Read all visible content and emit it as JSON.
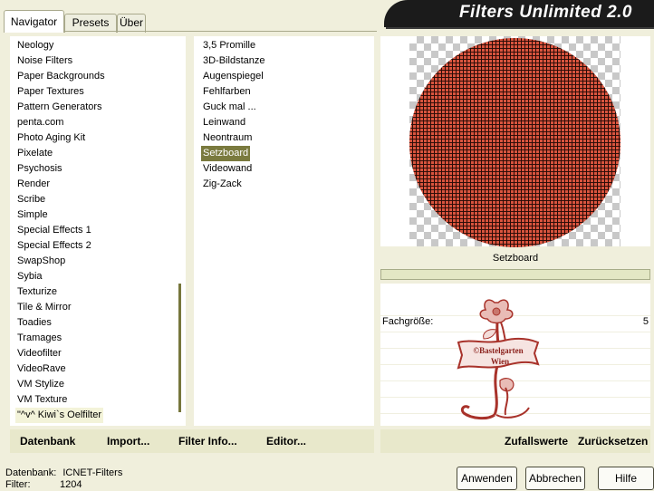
{
  "header": {
    "title": "Filters Unlimited 2.0"
  },
  "tabs": [
    {
      "label": "Navigator",
      "active": true
    },
    {
      "label": "Presets",
      "active": false
    },
    {
      "label": "Über",
      "active": false
    }
  ],
  "categories": [
    "Neology",
    "Noise Filters",
    "Paper Backgrounds",
    "Paper Textures",
    "Pattern Generators",
    "penta.com",
    "Photo Aging Kit",
    "Pixelate",
    "Psychosis",
    "Render",
    "Scribe",
    "Simple",
    "Special Effects 1",
    "Special Effects 2",
    "SwapShop",
    "Sybia",
    "Texturize",
    "Tile & Mirror",
    "Toadies",
    "Tramages",
    "Videofilter",
    "VideoRave",
    "VM Stylize",
    "VM Texture",
    "\"^v^ Kiwi`s Oelfilter"
  ],
  "selected_category": "\"^v^ Kiwi`s Oelfilter",
  "filters": [
    "3,5 Promille",
    "3D-Bildstanze",
    "Augenspiegel",
    "Fehlfarben",
    "Guck mal ...",
    "Leinwand",
    "Neontraum",
    "Setzboard",
    "Videowand",
    "Zig-Zack"
  ],
  "selected_filter": "Setzboard",
  "preview": {
    "filter_name": "Setzboard"
  },
  "params": {
    "label": "Fachgröße:",
    "value": "5"
  },
  "logo": {
    "line1": "©Bastelgarten",
    "line2": "Wien"
  },
  "toolbar": {
    "database": "Datenbank",
    "import": "Import...",
    "filter_info": "Filter Info...",
    "editor": "Editor...",
    "random": "Zufallswerte",
    "reset": "Zurücksetzen"
  },
  "status": {
    "database_label": "Datenbank:",
    "database_value": "ICNET-Filters",
    "filter_label": "Filter:",
    "filter_value": "1204"
  },
  "buttons": {
    "apply": "Anwenden",
    "cancel": "Abbrechen",
    "help": "Hilfe"
  },
  "colors": {
    "background": "#f0efdc",
    "selection": "#7a7a3e",
    "banner": "#1b1b1b",
    "pattern_red": "#d9543e",
    "logo": "#a8322a"
  }
}
